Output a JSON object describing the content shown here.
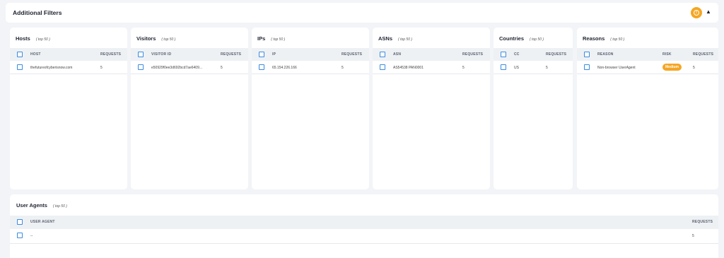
{
  "header": {
    "title": "Additional Filters"
  },
  "panels": [
    {
      "title": "Hosts",
      "subtitle": "( top 50 )",
      "columns": [
        "HOST",
        "REQUESTS"
      ],
      "row": [
        "thefutureofcyberisnow.com",
        "5"
      ]
    },
    {
      "title": "Visitors",
      "subtitle": "( top 50 )",
      "columns": [
        "VISITOR ID",
        "REQUESTS"
      ],
      "row": [
        "e50929f0ee3d692bcd7ae6409...",
        "5"
      ]
    },
    {
      "title": "IPs",
      "subtitle": "( top 50 )",
      "columns": [
        "IP",
        "REQUESTS"
      ],
      "row": [
        "65.154.226.166",
        "5"
      ]
    },
    {
      "title": "ASNs",
      "subtitle": "( top 50 )",
      "columns": [
        "ASN",
        "REQUESTS"
      ],
      "row": [
        "AS54538 PAN0001",
        "5"
      ]
    },
    {
      "title": "Countries",
      "subtitle": "( top 50 )",
      "columns": [
        "CC",
        "REQUESTS"
      ],
      "row": [
        "US",
        "5"
      ]
    },
    {
      "title": "Reasons",
      "subtitle": "( top 50 )",
      "columns": [
        "REASON",
        "RISK",
        "REQUESTS"
      ],
      "row": [
        "Non-browser UserAgent",
        "Medium",
        "5"
      ]
    }
  ],
  "user_agents": {
    "title": "User Agents",
    "subtitle": "( top 50 )",
    "columns": [
      "USER AGENT",
      "REQUESTS"
    ],
    "row": [
      "--",
      "5"
    ]
  },
  "colors": {
    "accent": "#f5a623",
    "checkbox": "#3a8be0"
  }
}
